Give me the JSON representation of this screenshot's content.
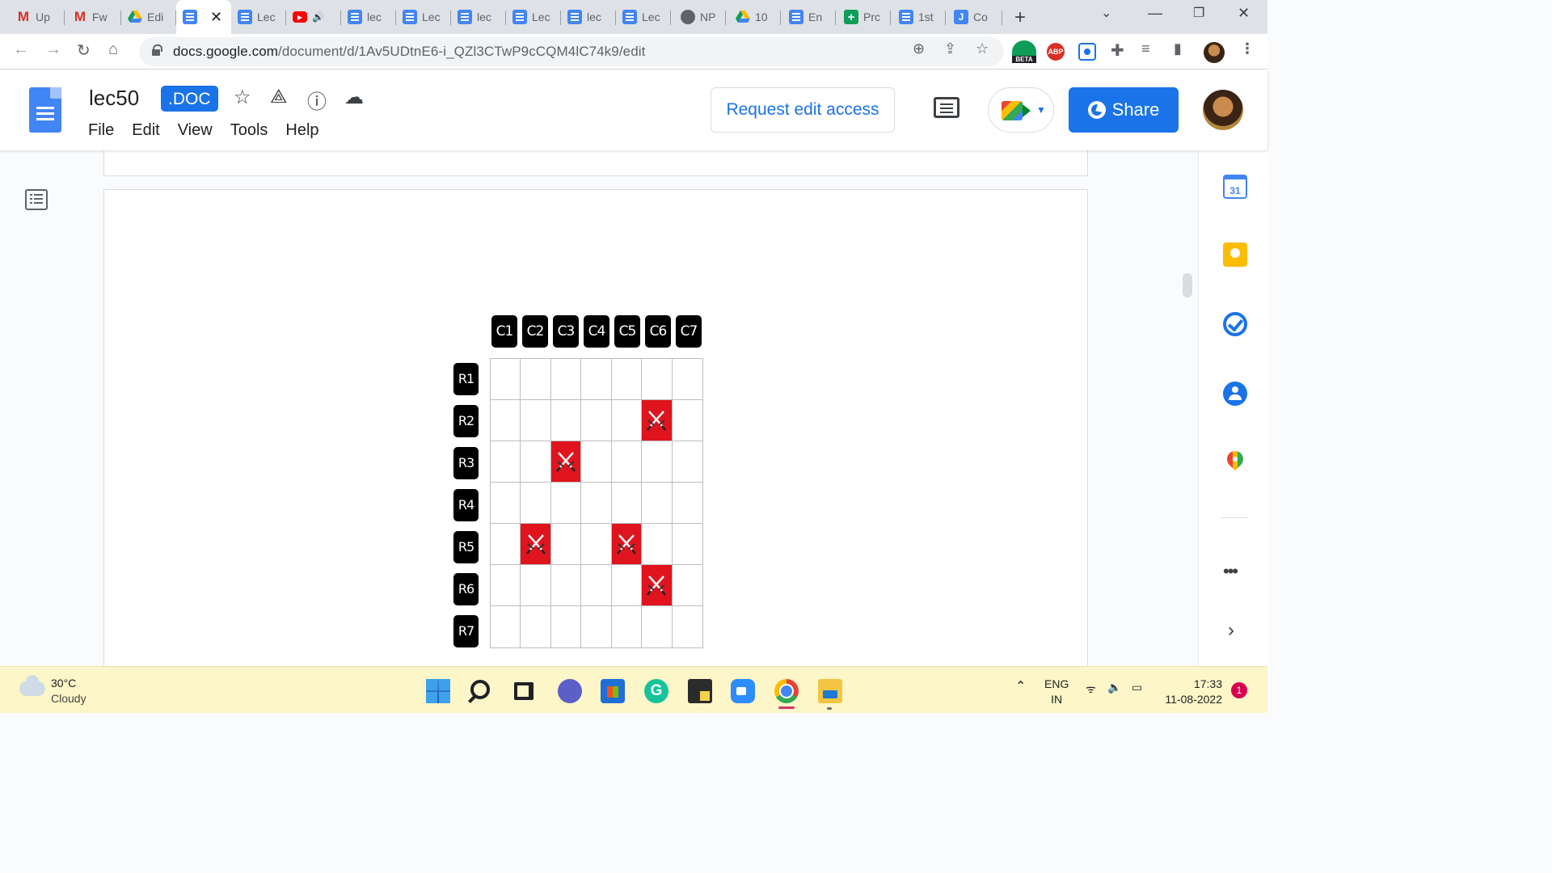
{
  "browser": {
    "tabs": [
      {
        "label": "Up",
        "icon": "gmail-icon"
      },
      {
        "label": "Fw",
        "icon": "gmail-icon"
      },
      {
        "label": "Edi",
        "icon": "drive-icon"
      },
      {
        "label": "",
        "icon": "docs-icon",
        "active": true
      },
      {
        "label": "Lec",
        "icon": "docs-icon"
      },
      {
        "label": "",
        "icon": "youtube-icon"
      },
      {
        "label": "lec",
        "icon": "docs-icon"
      },
      {
        "label": "Lec",
        "icon": "docs-icon"
      },
      {
        "label": "lec",
        "icon": "docs-icon"
      },
      {
        "label": "Lec",
        "icon": "docs-icon"
      },
      {
        "label": "lec",
        "icon": "docs-icon"
      },
      {
        "label": "Lec",
        "icon": "docs-icon"
      },
      {
        "label": "NP",
        "icon": "globe-icon"
      },
      {
        "label": "10",
        "icon": "drive-icon"
      },
      {
        "label": "En",
        "icon": "docs-icon"
      },
      {
        "label": "Prc",
        "icon": "sheets-icon"
      },
      {
        "label": "1st",
        "icon": "docs-icon"
      },
      {
        "label": "Co",
        "icon": "j-icon"
      }
    ],
    "url_host": "docs.google.com",
    "url_path": "/document/d/1Av5UDtnE6-i_QZl3CTwP9cCQM4lC74k9/edit",
    "ext_beta_label": "BETA",
    "ext_abp_label": "ABP"
  },
  "docs": {
    "title": "lec50",
    "badge": ".DOC",
    "menu": [
      "File",
      "Edit",
      "View",
      "Tools",
      "Help"
    ],
    "request_edit_label": "Request edit access",
    "share_label": "Share"
  },
  "board": {
    "columns": [
      "C1",
      "C2",
      "C3",
      "C4",
      "C5",
      "C6",
      "C7"
    ],
    "rows": [
      "R1",
      "R2",
      "R3",
      "R4",
      "R5",
      "R6",
      "R7"
    ],
    "marked_cells": [
      [
        1,
        5
      ],
      [
        2,
        2
      ],
      [
        4,
        1
      ],
      [
        4,
        4
      ],
      [
        5,
        5
      ]
    ],
    "mark_color": "#e0141e",
    "mark_icon": "crossed-swords-icon"
  },
  "sidepanel": {
    "calendar_day": "31",
    "more_label": "•••",
    "expand_label": "›"
  },
  "taskbar": {
    "temperature": "30°C",
    "weather": "Cloudy",
    "lang_line1": "ENG",
    "lang_line2": "IN",
    "time": "17:33",
    "date": "11-08-2022",
    "notification_count": "1"
  }
}
